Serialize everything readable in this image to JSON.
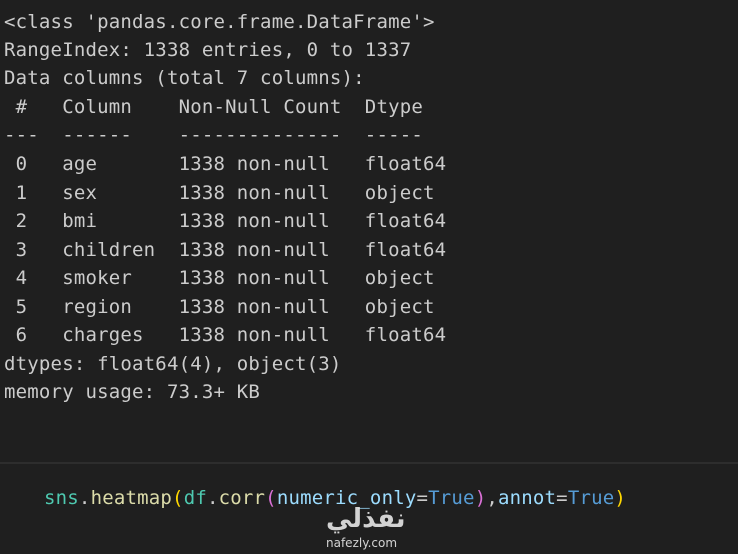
{
  "output": {
    "lines": [
      "<class 'pandas.core.frame.DataFrame'>",
      "RangeIndex: 1338 entries, 0 to 1337",
      "Data columns (total 7 columns):",
      " #   Column    Non-Null Count  Dtype  ",
      "---  ------    --------------  -----  ",
      " 0   age       1338 non-null   float64",
      " 1   sex       1338 non-null   object ",
      " 2   bmi       1338 non-null   float64",
      " 3   children  1338 non-null   float64",
      " 4   smoker    1338 non-null   object ",
      " 5   region    1338 non-null   object ",
      " 6   charges   1338 non-null   float64",
      "dtypes: float64(4), object(3)",
      "memory usage: 73.3+ KB"
    ]
  },
  "code": {
    "t1": "sns",
    "t2": ".",
    "t3": "heatmap",
    "t4": "(",
    "t5": "df",
    "t6": ".",
    "t7": "corr",
    "t8": "(",
    "t9": "numeric_only",
    "t10": "=",
    "t11": "True",
    "t12": ")",
    "t13": ",",
    "t14": "annot",
    "t15": "=",
    "t16": "True",
    "t17": ")"
  },
  "watermark": {
    "arabic": "نفذلي",
    "latin": "nafezly.com"
  },
  "colors": {
    "background": "#1f1f1f",
    "text": "#cccccc",
    "identifier": "#4ec9b0",
    "function": "#dcdcaa",
    "keyword": "#569cd6",
    "parameter": "#9cdcfe"
  }
}
